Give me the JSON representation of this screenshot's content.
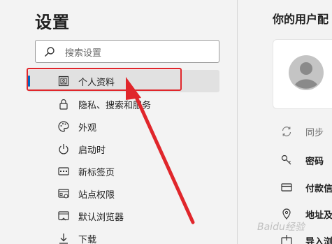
{
  "sidebar": {
    "title": "设置",
    "search_placeholder": "搜索设置",
    "items": [
      {
        "label": "个人资料",
        "icon": "profile-icon",
        "active": true
      },
      {
        "label": "隐私、搜索和服务",
        "icon": "lock-icon"
      },
      {
        "label": "外观",
        "icon": "palette-icon"
      },
      {
        "label": "启动时",
        "icon": "power-icon"
      },
      {
        "label": "新标签页",
        "icon": "new-tab-icon"
      },
      {
        "label": "站点权限",
        "icon": "site-permissions-icon"
      },
      {
        "label": "默认浏览器",
        "icon": "default-browser-icon"
      },
      {
        "label": "下载",
        "icon": "download-icon"
      }
    ]
  },
  "main": {
    "title": "你的用户配",
    "avatar_icon": "avatar-icon",
    "rows": [
      {
        "label": "同步",
        "icon": "sync-icon",
        "style": "gray"
      },
      {
        "label": "密码",
        "icon": "key-icon",
        "style": "bold"
      },
      {
        "label": "付款信",
        "icon": "card-icon",
        "style": "bold"
      },
      {
        "label": "地址及",
        "icon": "location-icon",
        "style": "bold"
      },
      {
        "label": "导入浏",
        "icon": "import-icon",
        "style": "bold"
      }
    ]
  },
  "annotation": {
    "color": "#e0262b"
  },
  "watermark": "Baidu经验",
  "colors": {
    "accent": "#0067c0",
    "background": "#f3f3f3",
    "active_item": "#e1e1e1"
  }
}
